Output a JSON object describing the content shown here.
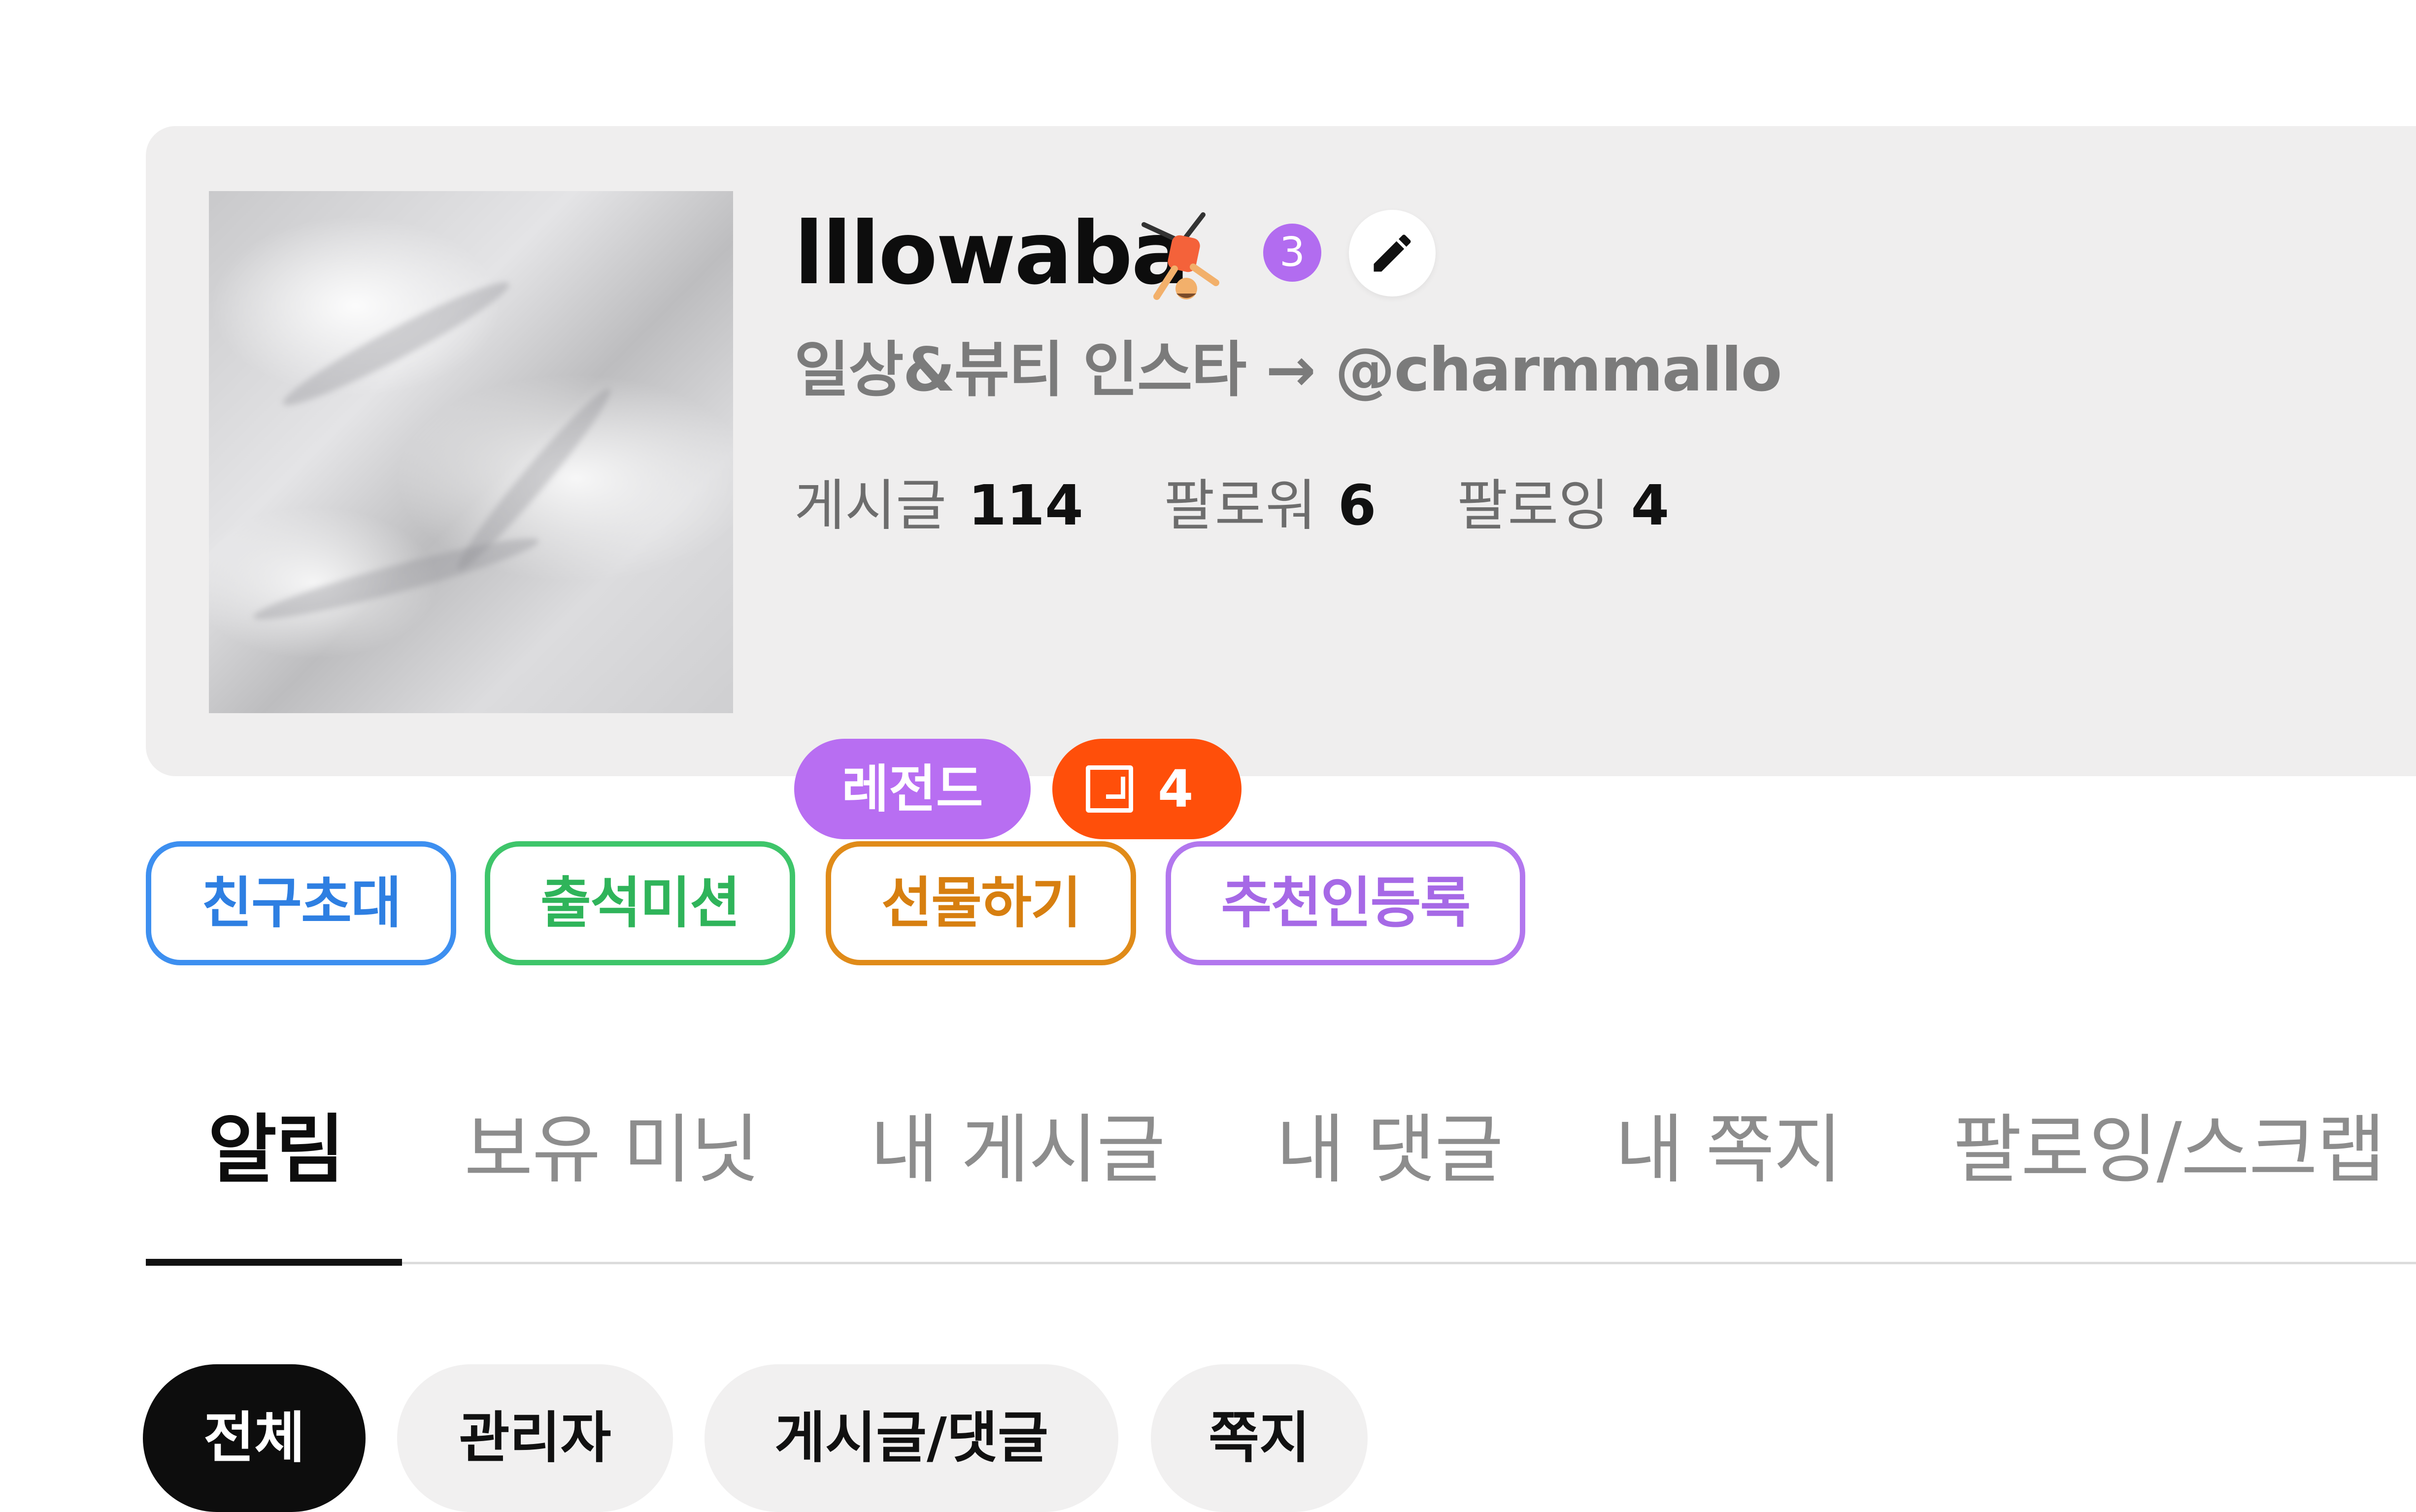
{
  "profile": {
    "username": "lllowaba",
    "level": "3",
    "bio": "일상&뷰티 인스타 → @charmmallo",
    "stats": [
      {
        "label": "게시글",
        "value": "114"
      },
      {
        "label": "팔로워",
        "value": "6"
      },
      {
        "label": "팔로잉",
        "value": "4"
      }
    ],
    "grade_badge": "레전드",
    "count_badge": "4"
  },
  "actions": {
    "invite": "친구초대",
    "attendance": "출석미션",
    "gift": "선물하기",
    "referral": "추천인등록"
  },
  "tabs": [
    {
      "label": "알림"
    },
    {
      "label": "보유 미닛"
    },
    {
      "label": "내 게시글"
    },
    {
      "label": "내 댓글"
    },
    {
      "label": "내 쪽지"
    },
    {
      "label": "팔로잉/스크랩"
    }
  ],
  "filters": [
    {
      "label": "전체"
    },
    {
      "label": "관리자"
    },
    {
      "label": "게시글/댓글"
    },
    {
      "label": "쪽지"
    }
  ],
  "colors": {
    "level_badge": "#b26cf0",
    "grade_badge": "#b86ef2",
    "count_badge": "#ff4f0a",
    "invite": "#3d8ff0",
    "attendance": "#3ec56a",
    "gift": "#e08b19",
    "referral": "#b277ee"
  }
}
